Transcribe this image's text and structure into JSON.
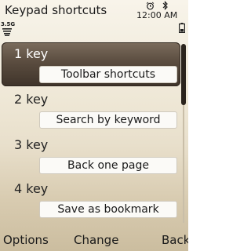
{
  "header": {
    "title": "Keypad shortcuts",
    "time": "12:00 AM",
    "network": "3.5G",
    "icons": [
      "alarm-icon",
      "bluetooth-icon",
      "signal-strength-icon",
      "battery-icon"
    ]
  },
  "list": {
    "items": [
      {
        "key": "1 key",
        "value": "Toolbar shortcuts",
        "selected": true
      },
      {
        "key": "2 key",
        "value": "Search by keyword",
        "selected": false
      },
      {
        "key": "3 key",
        "value": "Back one page",
        "selected": false
      },
      {
        "key": "4 key",
        "value": "Save as bookmark",
        "selected": false
      }
    ]
  },
  "softkeys": {
    "left": "Options",
    "middle": "Change",
    "right": "Back"
  },
  "colors": {
    "highlight": "#4a3e33",
    "background": "#efe8d7",
    "text": "#1a1a1a",
    "value_box": "#fbfaf7"
  }
}
